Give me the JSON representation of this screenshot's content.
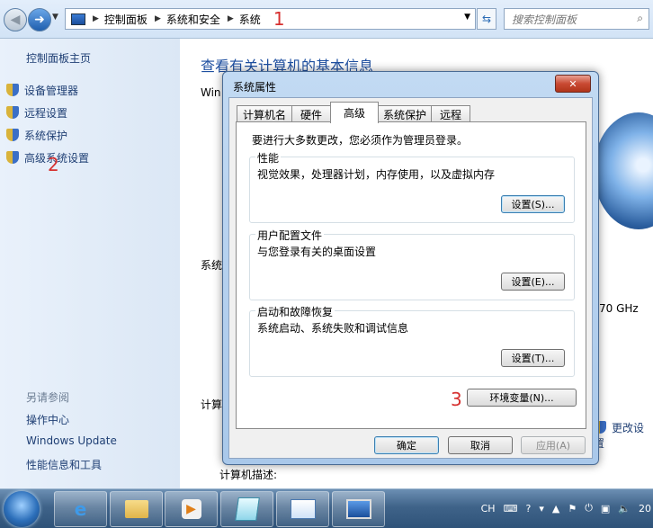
{
  "address_bar": {
    "breadcrumbs": [
      "控制面板",
      "系统和安全",
      "系统"
    ],
    "search_placeholder": "搜索控制面板",
    "annotation": "1"
  },
  "left_pane": {
    "home_link": "控制面板主页",
    "tasks": [
      "设备管理器",
      "远程设置",
      "系统保护",
      "高级系统设置"
    ],
    "annotation": "2",
    "see_also_title": "另请参阅",
    "see_also": [
      "操作中心",
      "Windows Update",
      "性能信息和工具"
    ]
  },
  "main": {
    "title": "查看有关计算机的基本信息",
    "fragments": {
      "win": "Win",
      "sys": "系统",
      "comp": "计算",
      "ghz": "70 GHz",
      "change_settings": "更改设置",
      "computer_desc": "计算机描述:"
    }
  },
  "dialog": {
    "title": "系统属性",
    "close_label": "✕",
    "tabs": [
      "计算机名",
      "硬件",
      "高级",
      "系统保护",
      "远程"
    ],
    "active_tab": "高级",
    "admin_note": "要进行大多数更改，您必须作为管理员登录。",
    "groups": [
      {
        "title": "性能",
        "desc": "视觉效果，处理器计划，内存使用，以及虚拟内存",
        "button": "设置(S)..."
      },
      {
        "title": "用户配置文件",
        "desc": "与您登录有关的桌面设置",
        "button": "设置(E)..."
      },
      {
        "title": "启动和故障恢复",
        "desc": "系统启动、系统失败和调试信息",
        "button": "设置(T)..."
      }
    ],
    "env_button": "环境变量(N)...",
    "annotation": "3",
    "ok_label": "确定",
    "cancel_label": "取消",
    "apply_label": "应用(A)"
  },
  "taskbar": {
    "tray": {
      "lang": "CH",
      "clock": "20"
    }
  },
  "colors": {
    "link": "#1f3f74",
    "title": "#1e4fa0",
    "annotation_red": "#d6302f"
  }
}
